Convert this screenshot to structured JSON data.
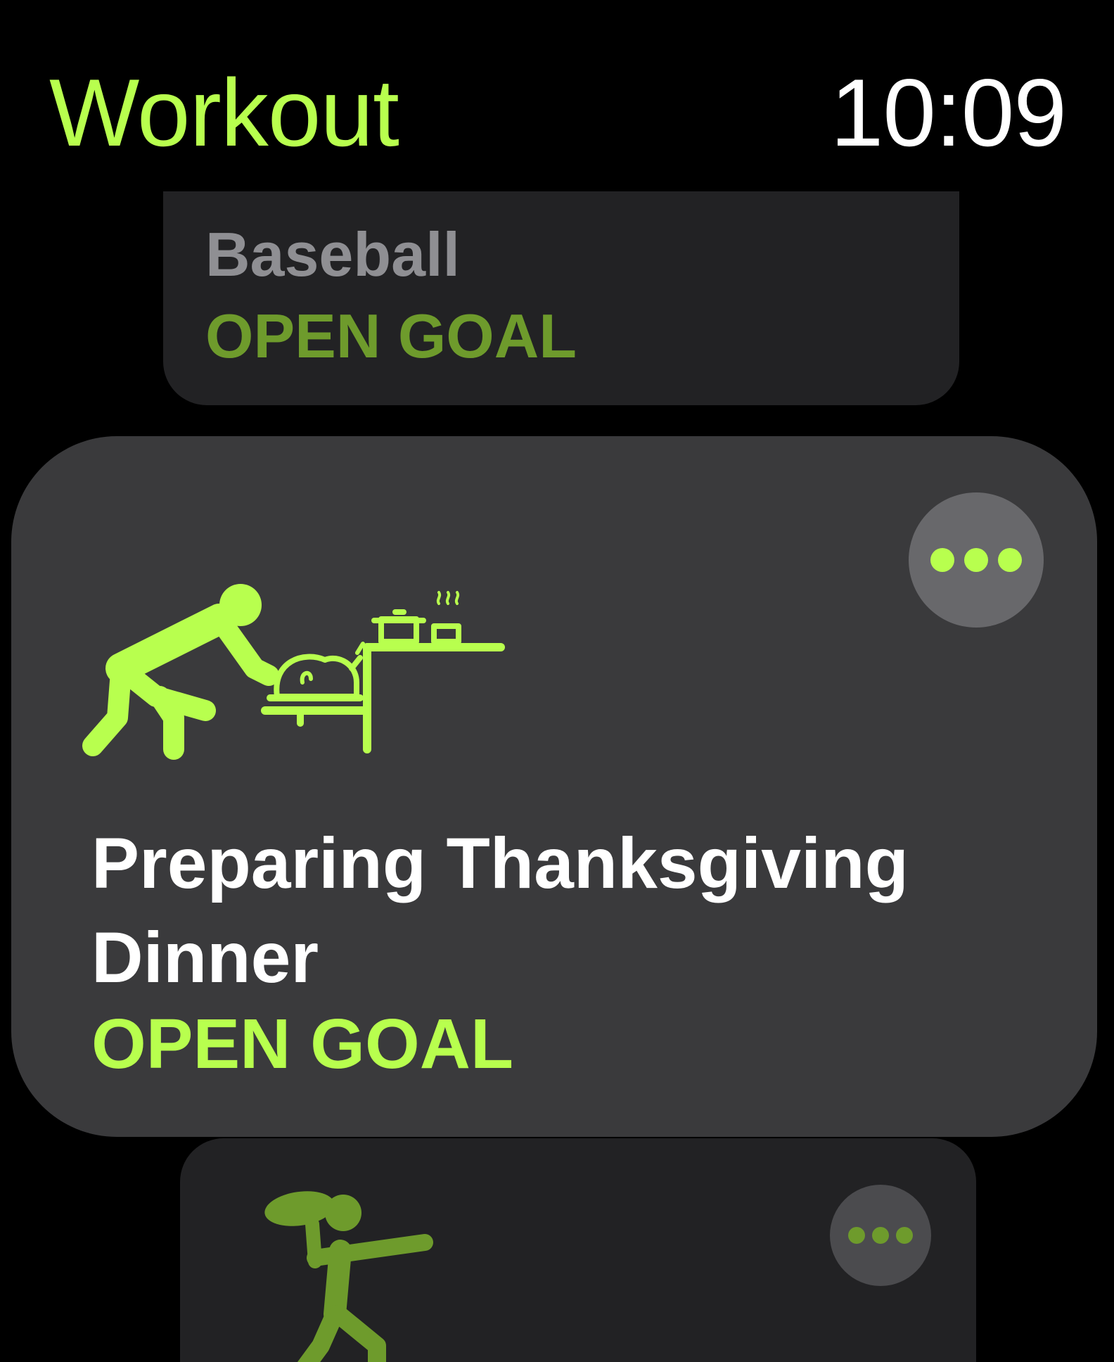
{
  "header": {
    "title": "Workout",
    "time": "10:09"
  },
  "workouts": {
    "previous": {
      "name": "Baseball",
      "goal": "OPEN GOAL",
      "icon": "baseball-icon"
    },
    "current": {
      "name": "Preparing Thanksgiving Dinner",
      "goal": "OPEN GOAL",
      "icon": "thanksgiving-cooking-icon",
      "more_icon": "ellipsis-icon"
    },
    "next": {
      "icon": "american-football-icon",
      "more_icon": "ellipsis-icon"
    }
  },
  "colors": {
    "accent": "#B8FF4E",
    "accent_dim": "#6E9B2C",
    "card_focused": "#3A3A3C",
    "card_dim": "#222224",
    "background": "#000000"
  }
}
